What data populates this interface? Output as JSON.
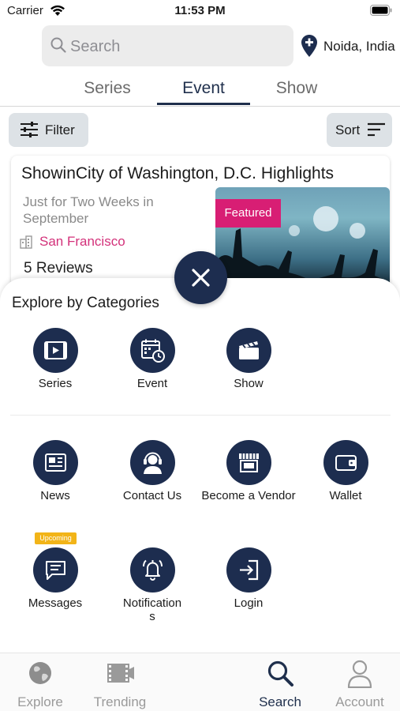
{
  "status_bar": {
    "carrier": "Carrier",
    "time": "11:53 PM"
  },
  "search": {
    "placeholder": "Search"
  },
  "location": {
    "label": "Noida, India"
  },
  "tabs": [
    {
      "label": "Series",
      "active": false
    },
    {
      "label": "Event",
      "active": true
    },
    {
      "label": "Show",
      "active": false
    }
  ],
  "toolbar": {
    "filter_label": "Filter",
    "sort_label": "Sort"
  },
  "event_card": {
    "title": "ShowinCity of Washington, D.C. Highlights",
    "subtitle": "Just for Two Weeks in September",
    "city": "San Francisco",
    "reviews": "5 Reviews",
    "badge": "Featured"
  },
  "sheet": {
    "title": "Explore by Categories",
    "categories": [
      {
        "label": "Series",
        "icon": "video-icon"
      },
      {
        "label": "Event",
        "icon": "calendar-clock-icon"
      },
      {
        "label": "Show",
        "icon": "clapperboard-icon"
      }
    ],
    "more": [
      {
        "label": "News",
        "icon": "newspaper-icon"
      },
      {
        "label": "Contact Us",
        "icon": "headset-agent-icon"
      },
      {
        "label": "Become a Vendor",
        "icon": "storefront-icon"
      },
      {
        "label": "Wallet",
        "icon": "wallet-icon"
      },
      {
        "label": "Messages",
        "icon": "message-icon",
        "badge": "Upcoming"
      },
      {
        "label": "Notifications",
        "icon": "bell-ring-icon"
      },
      {
        "label": "Login",
        "icon": "login-icon"
      }
    ]
  },
  "bottom_nav": [
    {
      "label": "Explore",
      "icon": "globe-icon",
      "active": false
    },
    {
      "label": "Trending",
      "icon": "film-icon",
      "active": false
    },
    {
      "label": "Search",
      "icon": "search-icon",
      "active": true
    },
    {
      "label": "Account",
      "icon": "user-icon",
      "active": false
    }
  ],
  "colors": {
    "primary_navy": "#1d2d4f",
    "featured_pink": "#d81e74",
    "city_pink": "#d3317a",
    "upcoming_yellow": "#f2b418"
  }
}
